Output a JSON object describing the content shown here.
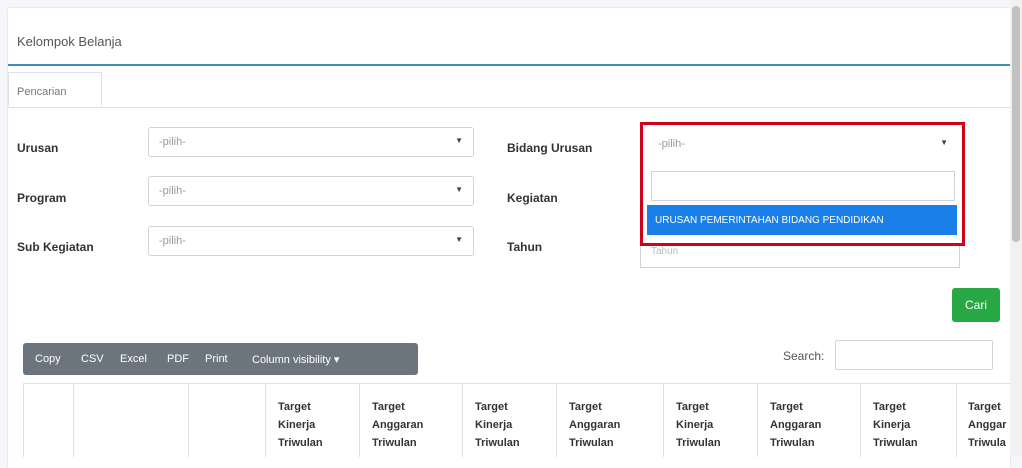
{
  "card": {
    "title": "Kelompok Belanja"
  },
  "tabs": [
    {
      "label": "Pencarian"
    }
  ],
  "form": {
    "urusan": {
      "label": "Urusan",
      "value": "-pilih-"
    },
    "program": {
      "label": "Program",
      "value": "-pilih-"
    },
    "sub_kegiatan": {
      "label": "Sub Kegiatan",
      "value": "-pilih-"
    },
    "bidang_urusan": {
      "label": "Bidang Urusan",
      "value": "-pilih-",
      "options": [
        "URUSAN PEMERINTAHAN BIDANG PENDIDIKAN"
      ]
    },
    "kegiatan": {
      "label": "Kegiatan"
    },
    "tahun": {
      "label": "Tahun",
      "placeholder": "Tahun"
    }
  },
  "buttons": {
    "cari": "Cari"
  },
  "export_buttons": [
    "Copy",
    "CSV",
    "Excel",
    "PDF",
    "Print",
    "Column visibility ▾"
  ],
  "search": {
    "label": "Search:"
  },
  "table": {
    "headers": [
      [
        "Target",
        "Kinerja",
        "Triwulan"
      ],
      [
        "Target",
        "Anggaran",
        "Triwulan"
      ],
      [
        "Target",
        "Kinerja",
        "Triwulan"
      ],
      [
        "Target",
        "Anggaran",
        "Triwulan"
      ],
      [
        "Target",
        "Kinerja",
        "Triwulan"
      ],
      [
        "Target",
        "Anggaran",
        "Triwulan"
      ],
      [
        "Target",
        "Kinerja",
        "Triwulan"
      ],
      [
        "Target",
        "Anggar",
        "Triwula"
      ]
    ]
  },
  "colors": {
    "accent": "#3c8dbc",
    "highlight": "#d0021b",
    "selected_option": "#1a7fe8",
    "cari_button": "#28a745",
    "export_bar": "#6c757d"
  }
}
